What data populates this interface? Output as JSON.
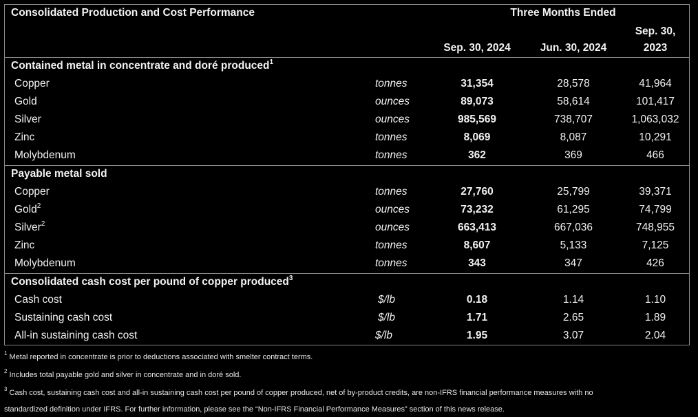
{
  "title": "Consolidated Production and Cost Performance",
  "period_header": "Three Months Ended",
  "columns": [
    "Sep. 30, 2024",
    "Jun. 30, 2024",
    "Sep. 30,",
    "2023"
  ],
  "sections": [
    {
      "heading": "Contained metal in concentrate and doré produced",
      "footnote_ref": "1",
      "rows": [
        {
          "label": "Copper",
          "sup": "",
          "unit": "tonnes",
          "values": [
            "31,354",
            "28,578",
            "41,964"
          ]
        },
        {
          "label": "Gold",
          "sup": "",
          "unit": "ounces",
          "values": [
            "89,073",
            "58,614",
            "101,417"
          ]
        },
        {
          "label": "Silver",
          "sup": "",
          "unit": "ounces",
          "values": [
            "985,569",
            "738,707",
            "1,063,032"
          ]
        },
        {
          "label": "Zinc",
          "sup": "",
          "unit": "tonnes",
          "values": [
            "8,069",
            "8,087",
            "10,291"
          ]
        },
        {
          "label": "Molybdenum",
          "sup": "",
          "unit": "tonnes",
          "values": [
            "362",
            "369",
            "466"
          ]
        }
      ]
    },
    {
      "heading": "Payable metal sold",
      "footnote_ref": "",
      "rows": [
        {
          "label": "Copper",
          "sup": "",
          "unit": "tonnes",
          "values": [
            "27,760",
            "25,799",
            "39,371"
          ]
        },
        {
          "label": "Gold",
          "sup": "2",
          "unit": "ounces",
          "values": [
            "73,232",
            "61,295",
            "74,799"
          ]
        },
        {
          "label": "Silver",
          "sup": "2",
          "unit": "ounces",
          "values": [
            "663,413",
            "667,036",
            "748,955"
          ]
        },
        {
          "label": "Zinc",
          "sup": "",
          "unit": "tonnes",
          "values": [
            "8,607",
            "5,133",
            "7,125"
          ]
        },
        {
          "label": "Molybdenum",
          "sup": "",
          "unit": "tonnes",
          "values": [
            "343",
            "347",
            "426"
          ]
        }
      ]
    },
    {
      "heading": "Consolidated cash cost per pound of copper produced",
      "footnote_ref": "3",
      "rows": [
        {
          "label": "Cash cost",
          "sup": "",
          "unit": "$/lb",
          "values": [
            "0.18",
            "1.14",
            "1.10"
          ]
        },
        {
          "label": "Sustaining cash cost",
          "sup": "",
          "unit": "$/lb",
          "values": [
            "1.71",
            "2.65",
            "1.89"
          ]
        },
        {
          "label": "All-in sustaining cash cost",
          "sup": "",
          "unit": "$/lb",
          "values": [
            "1.95",
            "3.07",
            "2.04"
          ]
        }
      ]
    }
  ],
  "footnotes": [
    {
      "num": "1",
      "text": "Metal reported in concentrate is prior to deductions associated with smelter contract terms."
    },
    {
      "num": "2",
      "text": "Includes total payable gold and silver in concentrate and in doré sold."
    },
    {
      "num": "3",
      "text": "Cash cost, sustaining cash cost and all-in sustaining cash cost per pound of copper produced, net of by-product credits, are non-IFRS financial performance measures with no"
    },
    {
      "num": "",
      "text": "standardized definition under IFRS. For further information, please see the “Non-IFRS Financial Performance Measures” section of this news release."
    }
  ]
}
